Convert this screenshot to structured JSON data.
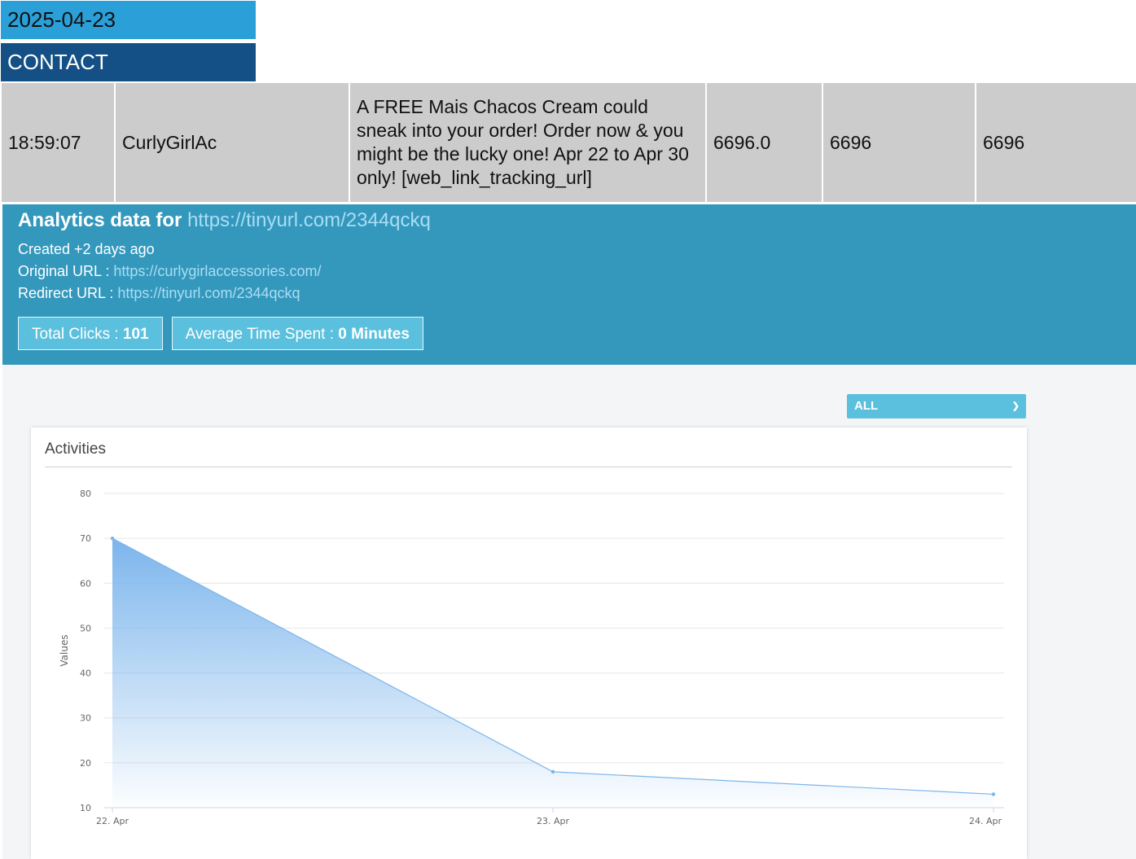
{
  "header": {
    "date": "2025-04-23",
    "contact_label": "CONTACT"
  },
  "message_row": {
    "time": "18:59:07",
    "sender": "CurlyGirlAc",
    "message": "A FREE Mais Chacos Cream could sneak into your order! Order now & you might be the lucky one! Apr 22 to Apr 30 only! [web_link_tracking_url]",
    "value_a": "6696.0",
    "value_b": "6696",
    "value_c": "6696"
  },
  "analytics": {
    "title_prefix": "Analytics data for",
    "title_url": "https://tinyurl.com/2344qckq",
    "created": "Created +2 days ago",
    "original_label": "Original URL :",
    "original_url": "https://curlygirlaccessories.com/",
    "redirect_label": "Redirect URL :",
    "redirect_url": "https://tinyurl.com/2344qckq",
    "total_clicks_label": "Total Clicks :",
    "total_clicks_value": "101",
    "avg_time_label": "Average Time Spent :",
    "avg_time_value": "0 Minutes"
  },
  "filter": {
    "selected": "ALL",
    "chevron_icon": "chevron-down-icon"
  },
  "chart_card": {
    "title": "Activities"
  },
  "chart_data": {
    "type": "area",
    "x": [
      "22. Apr",
      "23. Apr",
      "24. Apr"
    ],
    "series": [
      {
        "values": [
          70,
          18,
          13
        ]
      }
    ],
    "ylabel": "Values",
    "xlabel": "",
    "ylim": [
      10,
      80
    ],
    "yticks": [
      10,
      20,
      30,
      40,
      50,
      60,
      70,
      80
    ],
    "grid": true,
    "colors": {
      "line": "#7cb5ec",
      "fill_top": "#7cb5ec"
    }
  }
}
